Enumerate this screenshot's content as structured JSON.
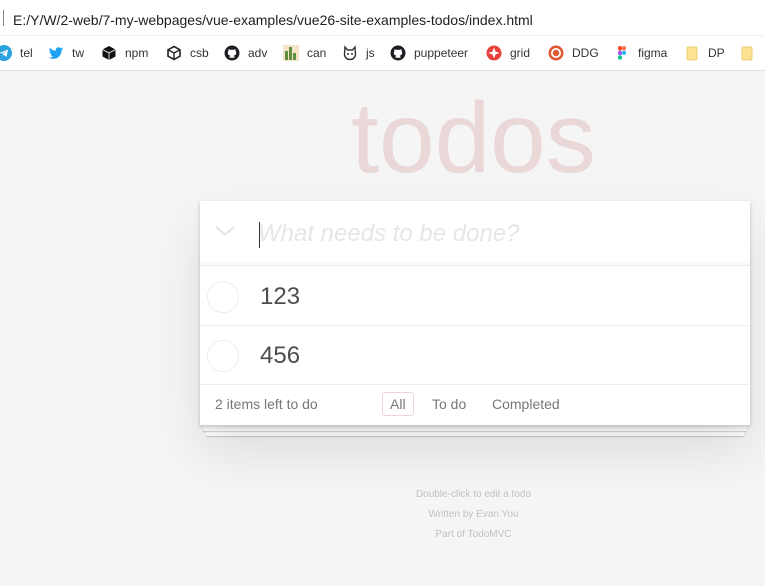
{
  "browser": {
    "url": "E:/Y/W/2-web/7-my-webpages/vue-examples/vue26-site-examples-todos/index.html",
    "bookmarks": [
      {
        "label": "tel",
        "icon": "telegram-icon"
      },
      {
        "label": "tw",
        "icon": "twitter-icon"
      },
      {
        "label": "npm",
        "icon": "npm-icon"
      },
      {
        "label": "csb",
        "icon": "codesandbox-icon"
      },
      {
        "label": "adv",
        "icon": "github-icon"
      },
      {
        "label": "can",
        "icon": "caniuse-icon"
      },
      {
        "label": "js",
        "icon": "js-cat-icon"
      },
      {
        "label": "puppeteer",
        "icon": "github-icon"
      },
      {
        "label": "grid",
        "icon": "grid-icon"
      },
      {
        "label": "DDG",
        "icon": "duckduckgo-icon"
      },
      {
        "label": "figma",
        "icon": "figma-icon"
      },
      {
        "label": "DP",
        "icon": "folder-icon"
      }
    ]
  },
  "app": {
    "title": "todos",
    "new_todo_placeholder": "What needs to be done?",
    "new_todo_value": "",
    "todos": [
      {
        "title": "123",
        "completed": false
      },
      {
        "title": "456",
        "completed": false
      }
    ],
    "footer": {
      "count_text": "2 items left to do",
      "filters": [
        {
          "label": "All",
          "selected": true
        },
        {
          "label": "To do",
          "selected": false
        },
        {
          "label": "Completed",
          "selected": false
        }
      ]
    }
  },
  "info": {
    "line1": "Double-click to edit a todo",
    "line2": "Written by Evan You",
    "line3": "Part of TodoMVC"
  },
  "colors": {
    "title": "#af2f2f",
    "background": "#f5f5f5",
    "text": "#4d4d4d"
  }
}
